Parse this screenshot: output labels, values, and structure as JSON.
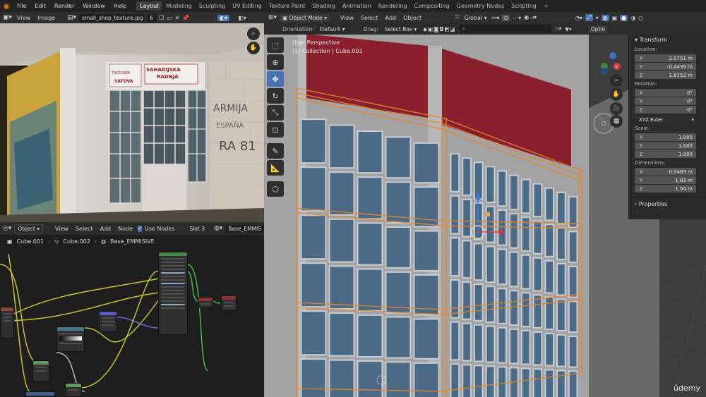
{
  "topbar": {
    "menus": [
      "File",
      "Edit",
      "Render",
      "Window",
      "Help"
    ],
    "workspaces": [
      "Layout",
      "Modeling",
      "Sculpting",
      "UV Editing",
      "Texture Paint",
      "Shading",
      "Animation",
      "Rendering",
      "Compositing",
      "Geometry Nodes",
      "Scripting"
    ],
    "active_workspace": "Layout",
    "add_tab": "+"
  },
  "image_editor": {
    "view": "View",
    "image": "Image",
    "filename": "small_shop_texture.jpg",
    "users": "6",
    "photo_signs": {
      "sign_left": "TRGOVINA\nSATOVA",
      "sign_right": "SAHADIJSKA\nRADNJA",
      "graffiti": "ARMIJA\nESPAÑA\nRA 81"
    }
  },
  "node_editor": {
    "mode": "Object",
    "view": "View",
    "select": "Select",
    "add": "Add",
    "node": "Node",
    "use_nodes": "Use Nodes",
    "slot": "Slot 3",
    "material": "Base_EMMIS",
    "breadcrumb": [
      "Cube.001",
      "Cube.002",
      "Base_EMMISIVE"
    ]
  },
  "viewport": {
    "mode": "Object Mode",
    "menus": [
      "View",
      "Select",
      "Add",
      "Object"
    ],
    "transform_orientation": "Global",
    "orientation_label": "Orientation:",
    "orientation_value": "Default",
    "drag_label": "Drag:",
    "drag_value": "Select Box",
    "options": "Optio",
    "overlay_title": "User Perspective",
    "overlay_subtitle": "(1) Collection | Cube.001",
    "watermark": "ûdemy"
  },
  "properties_panel": {
    "transform_title": "Transform",
    "location_label": "Location:",
    "location": [
      {
        "k": "X",
        "v": "2.0751 m"
      },
      {
        "k": "Y",
        "v": "-0.4439 m"
      },
      {
        "k": "Z",
        "v": "1.6152 m"
      }
    ],
    "rotation_label": "Rotation:",
    "rotation": [
      {
        "k": "X",
        "v": "0°"
      },
      {
        "k": "Y",
        "v": "0°"
      },
      {
        "k": "Z",
        "v": "0°"
      }
    ],
    "rotation_mode": "XYZ Euler",
    "scale_label": "Scale:",
    "scale": [
      {
        "k": "X",
        "v": "1.000"
      },
      {
        "k": "Y",
        "v": "1.000"
      },
      {
        "k": "Z",
        "v": "1.000"
      }
    ],
    "dimensions_label": "Dimensions:",
    "dimensions": [
      {
        "k": "X",
        "v": "0.0469 m"
      },
      {
        "k": "Y",
        "v": "1.83 m"
      },
      {
        "k": "Z",
        "v": "1.54 m"
      }
    ],
    "properties_title": "Properties"
  },
  "colors": {
    "accent_blue": "#4772b3",
    "selection_orange": "#e8872a",
    "wall_red": "#8a1f2e",
    "glass_blue": "#4b6a85",
    "frame_light": "#b8bfc6"
  }
}
